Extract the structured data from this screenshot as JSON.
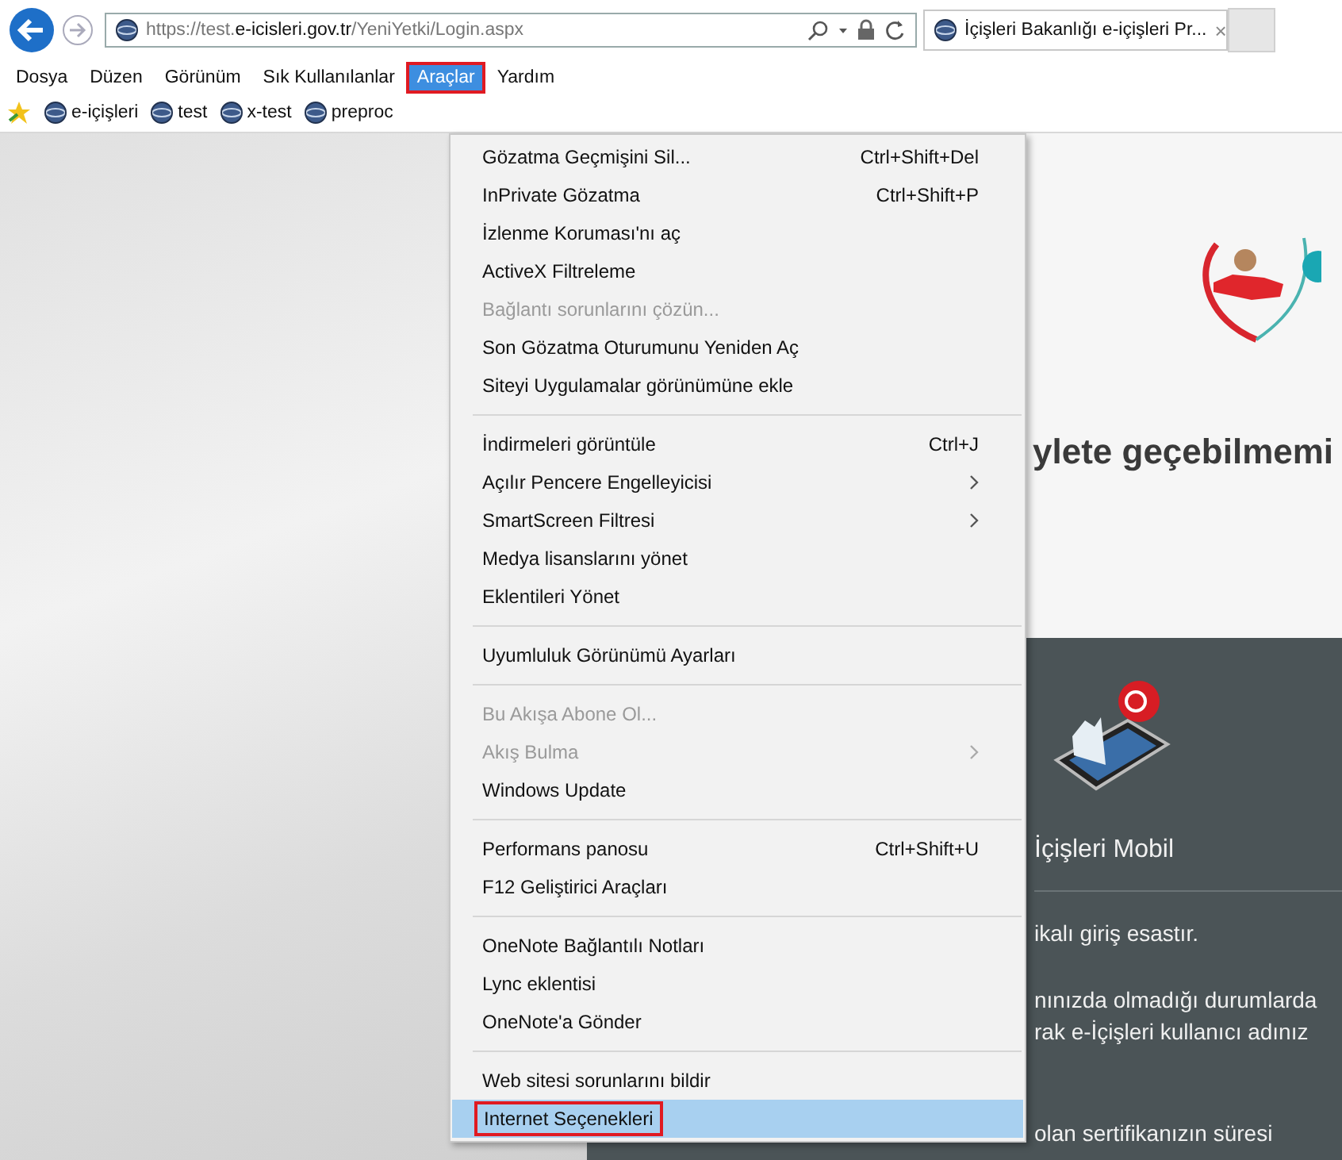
{
  "browser": {
    "address": {
      "host_prefix": "https://test.",
      "host": "e-icisleri.gov.tr",
      "path": "/YeniYetki/Login.aspx"
    },
    "tab": {
      "title": "İçişleri Bakanlığı e-içişleri Pr...",
      "close": "×"
    }
  },
  "menu_bar": [
    {
      "label": "Dosya",
      "selected": false,
      "outlined": false
    },
    {
      "label": "Düzen",
      "selected": false,
      "outlined": false
    },
    {
      "label": "Görünüm",
      "selected": false,
      "outlined": false
    },
    {
      "label": "Sık Kullanılanlar",
      "selected": false,
      "outlined": false
    },
    {
      "label": "Araçlar",
      "selected": true,
      "outlined": true
    },
    {
      "label": "Yardım",
      "selected": false,
      "outlined": false
    }
  ],
  "favorites": [
    {
      "label": "e-içişleri"
    },
    {
      "label": "test"
    },
    {
      "label": "x-test"
    },
    {
      "label": "preproc"
    }
  ],
  "tools_menu": [
    {
      "kind": "item",
      "label": "Gözatma Geçmişini Sil...",
      "shortcut": "Ctrl+Shift+Del",
      "disabled": false,
      "submenu": false,
      "selected": false,
      "outlined": false
    },
    {
      "kind": "item",
      "label": "InPrivate Gözatma",
      "shortcut": "Ctrl+Shift+P",
      "disabled": false,
      "submenu": false,
      "selected": false,
      "outlined": false
    },
    {
      "kind": "item",
      "label": "İzlenme Koruması'nı aç",
      "disabled": false,
      "submenu": false,
      "selected": false,
      "outlined": false
    },
    {
      "kind": "item",
      "label": "ActiveX Filtreleme",
      "disabled": false,
      "submenu": false,
      "selected": false,
      "outlined": false
    },
    {
      "kind": "item",
      "label": "Bağlantı sorunlarını çözün...",
      "disabled": true,
      "submenu": false,
      "selected": false,
      "outlined": false
    },
    {
      "kind": "item",
      "label": "Son Gözatma Oturumunu Yeniden Aç",
      "disabled": false,
      "submenu": false,
      "selected": false,
      "outlined": false
    },
    {
      "kind": "item",
      "label": "Siteyi Uygulamalar görünümüne ekle",
      "disabled": false,
      "submenu": false,
      "selected": false,
      "outlined": false
    },
    {
      "kind": "separator"
    },
    {
      "kind": "item",
      "label": "İndirmeleri görüntüle",
      "shortcut": "Ctrl+J",
      "disabled": false,
      "submenu": false,
      "selected": false,
      "outlined": false
    },
    {
      "kind": "item",
      "label": "Açılır Pencere Engelleyicisi",
      "disabled": false,
      "submenu": true,
      "selected": false,
      "outlined": false
    },
    {
      "kind": "item",
      "label": "SmartScreen Filtresi",
      "disabled": false,
      "submenu": true,
      "selected": false,
      "outlined": false
    },
    {
      "kind": "item",
      "label": "Medya lisanslarını yönet",
      "disabled": false,
      "submenu": false,
      "selected": false,
      "outlined": false
    },
    {
      "kind": "item",
      "label": "Eklentileri Yönet",
      "disabled": false,
      "submenu": false,
      "selected": false,
      "outlined": false
    },
    {
      "kind": "separator"
    },
    {
      "kind": "item",
      "label": "Uyumluluk Görünümü Ayarları",
      "disabled": false,
      "submenu": false,
      "selected": false,
      "outlined": false
    },
    {
      "kind": "separator"
    },
    {
      "kind": "item",
      "label": "Bu Akışa Abone Ol...",
      "disabled": true,
      "submenu": false,
      "selected": false,
      "outlined": false
    },
    {
      "kind": "item",
      "label": "Akış Bulma",
      "disabled": true,
      "submenu": true,
      "selected": false,
      "outlined": false
    },
    {
      "kind": "item",
      "label": "Windows Update",
      "disabled": false,
      "submenu": false,
      "selected": false,
      "outlined": false
    },
    {
      "kind": "separator"
    },
    {
      "kind": "item",
      "label": "Performans panosu",
      "shortcut": "Ctrl+Shift+U",
      "disabled": false,
      "submenu": false,
      "selected": false,
      "outlined": false
    },
    {
      "kind": "item",
      "label": "F12 Geliştirici Araçları",
      "disabled": false,
      "submenu": false,
      "selected": false,
      "outlined": false
    },
    {
      "kind": "separator"
    },
    {
      "kind": "item",
      "label": "OneNote Bağlantılı Notları",
      "disabled": false,
      "submenu": false,
      "selected": false,
      "outlined": false
    },
    {
      "kind": "item",
      "label": "Lync eklentisi",
      "disabled": false,
      "submenu": false,
      "selected": false,
      "outlined": false
    },
    {
      "kind": "item",
      "label": "OneNote'a Gönder",
      "disabled": false,
      "submenu": false,
      "selected": false,
      "outlined": false
    },
    {
      "kind": "separator"
    },
    {
      "kind": "item",
      "label": "Web sitesi sorunlarını bildir",
      "disabled": false,
      "submenu": false,
      "selected": false,
      "outlined": false
    },
    {
      "kind": "item",
      "label": "Internet Seçenekleri",
      "disabled": false,
      "submenu": false,
      "selected": true,
      "outlined": true
    }
  ],
  "page": {
    "headline": "ylete geçebilmemi",
    "mobile_title": "İçişleri Mobil",
    "lines": [
      "ikalı giriş esastır.",
      "nınızda olmadığı durumlarda",
      "rak e-İçişleri kullanıcı adınız"
    ],
    "bottom_line": "olan sertifikanızın süresi"
  }
}
